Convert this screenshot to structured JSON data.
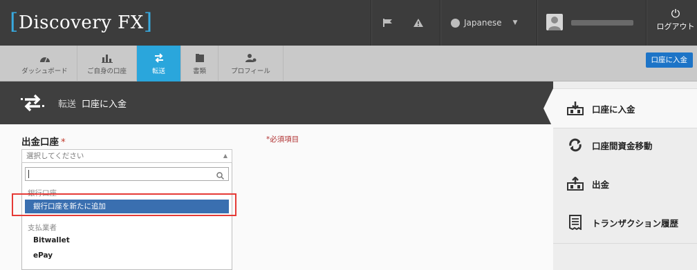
{
  "app": {
    "logo_text": "Discovery FX",
    "bracket_left": "[",
    "bracket_right": "]"
  },
  "header": {
    "language": "Japanese",
    "logout_label": "ログアウト"
  },
  "nav": {
    "tabs": [
      {
        "label": "ダッシュボード",
        "icon": "dashboard-icon"
      },
      {
        "label": "ご自身の口座",
        "icon": "bar-chart-icon"
      },
      {
        "label": "転送",
        "icon": "transfer-icon",
        "active": true
      },
      {
        "label": "書類",
        "icon": "document-icon"
      },
      {
        "label": "プロフィール",
        "icon": "profile-icon"
      }
    ],
    "deposit_button": "口座に入金"
  },
  "page": {
    "breadcrumb_root": "転送",
    "breadcrumb_current": "口座に入金"
  },
  "form": {
    "field_label": "出金口座",
    "required_star": "*",
    "required_note": "*必須項目",
    "select_placeholder": "選択してください",
    "search_value": "",
    "groups": [
      {
        "label": "銀行口座",
        "options": [
          "銀行口座を新たに追加"
        ]
      },
      {
        "label": "支払業者",
        "options": [
          "Bitwallet",
          "ePay"
        ]
      }
    ],
    "highlighted_option": "銀行口座を新たに追加"
  },
  "sidebar": {
    "items": [
      {
        "label": "口座に入金",
        "icon": "deposit-icon",
        "active": true
      },
      {
        "label": "口座間資金移動",
        "icon": "internal-transfer-icon"
      },
      {
        "label": "出金",
        "icon": "withdraw-icon"
      },
      {
        "label": "トランザクション履歴",
        "icon": "receipt-icon"
      }
    ]
  },
  "colors": {
    "accent": "#2aa6dc",
    "header_bg": "#3c3c3c",
    "highlight_option": "#3a6fb0",
    "callout_border": "#e53935",
    "required_text": "#b03030"
  }
}
